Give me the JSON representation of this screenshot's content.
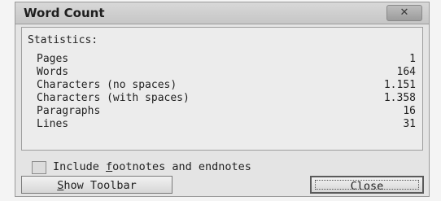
{
  "dialog": {
    "title": "Word Count",
    "close_glyph": "✕"
  },
  "statistics": {
    "heading": "Statistics:",
    "rows": [
      {
        "label": "Pages",
        "value": "1"
      },
      {
        "label": "Words",
        "value": "164"
      },
      {
        "label": "Characters (no spaces)",
        "value": "1.151"
      },
      {
        "label": "Characters (with spaces)",
        "value": "1.358"
      },
      {
        "label": "Paragraphs",
        "value": "16"
      },
      {
        "label": "Lines",
        "value": "31"
      }
    ]
  },
  "options": {
    "include_notes": {
      "label_before": "Include ",
      "label_underlined": "f",
      "label_after": "ootnotes and endnotes",
      "checked": false
    }
  },
  "buttons": {
    "show_toolbar": {
      "underlined": "S",
      "rest": "how Toolbar"
    },
    "close": {
      "label": "Close"
    }
  }
}
